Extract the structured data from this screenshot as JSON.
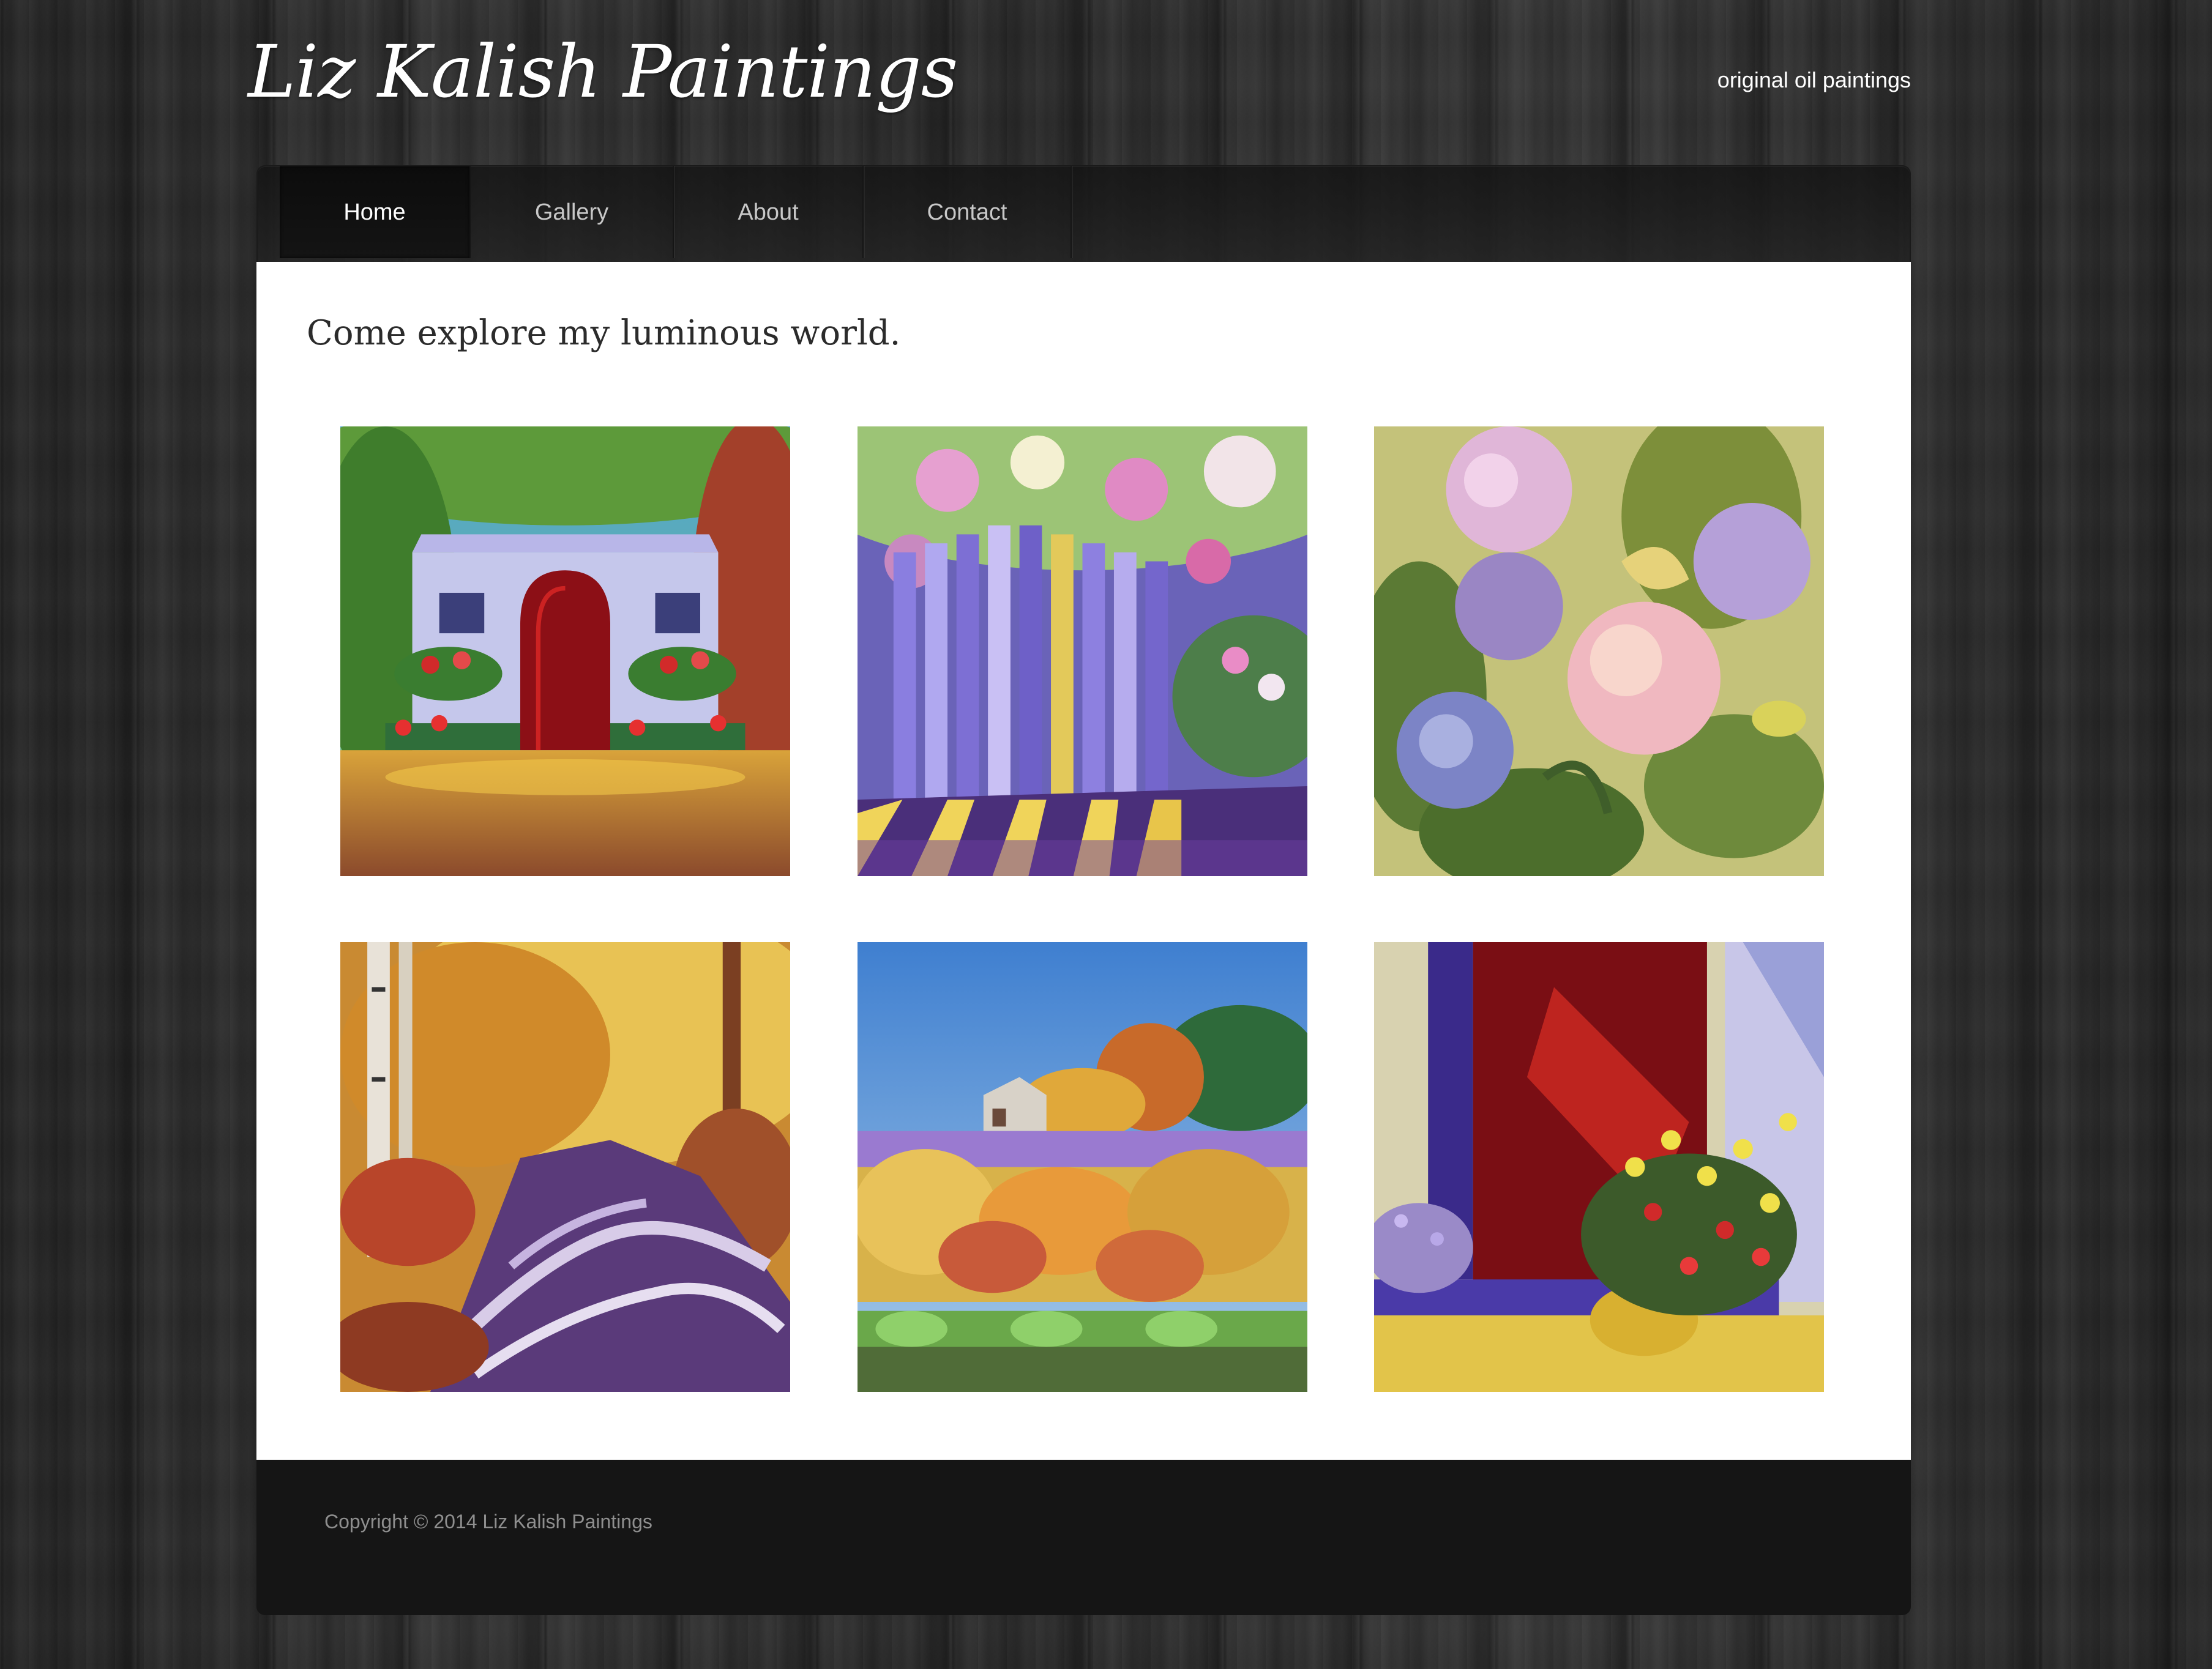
{
  "header": {
    "site_title": "Liz Kalish Paintings",
    "tagline": "original oil paintings"
  },
  "nav": {
    "items": [
      {
        "label": "Home",
        "active": true
      },
      {
        "label": "Gallery",
        "active": false
      },
      {
        "label": "About",
        "active": false
      },
      {
        "label": "Contact",
        "active": false
      }
    ]
  },
  "main": {
    "headline": "Come explore my luminous world.",
    "gallery": [
      {
        "subject": "cottage with red door and flower boxes"
      },
      {
        "subject": "purple fence with roses"
      },
      {
        "subject": "hydrangea flowers"
      },
      {
        "subject": "autumn forest stream"
      },
      {
        "subject": "autumn trees with barn"
      },
      {
        "subject": "red door with sunflowers"
      }
    ]
  },
  "footer": {
    "copyright": "Copyright © 2014 Liz Kalish Paintings"
  },
  "colors": {
    "page_background": "#2b2b2b",
    "content_background": "#ffffff",
    "footer_background": "#151515",
    "nav_active": "#0c0c0c"
  }
}
